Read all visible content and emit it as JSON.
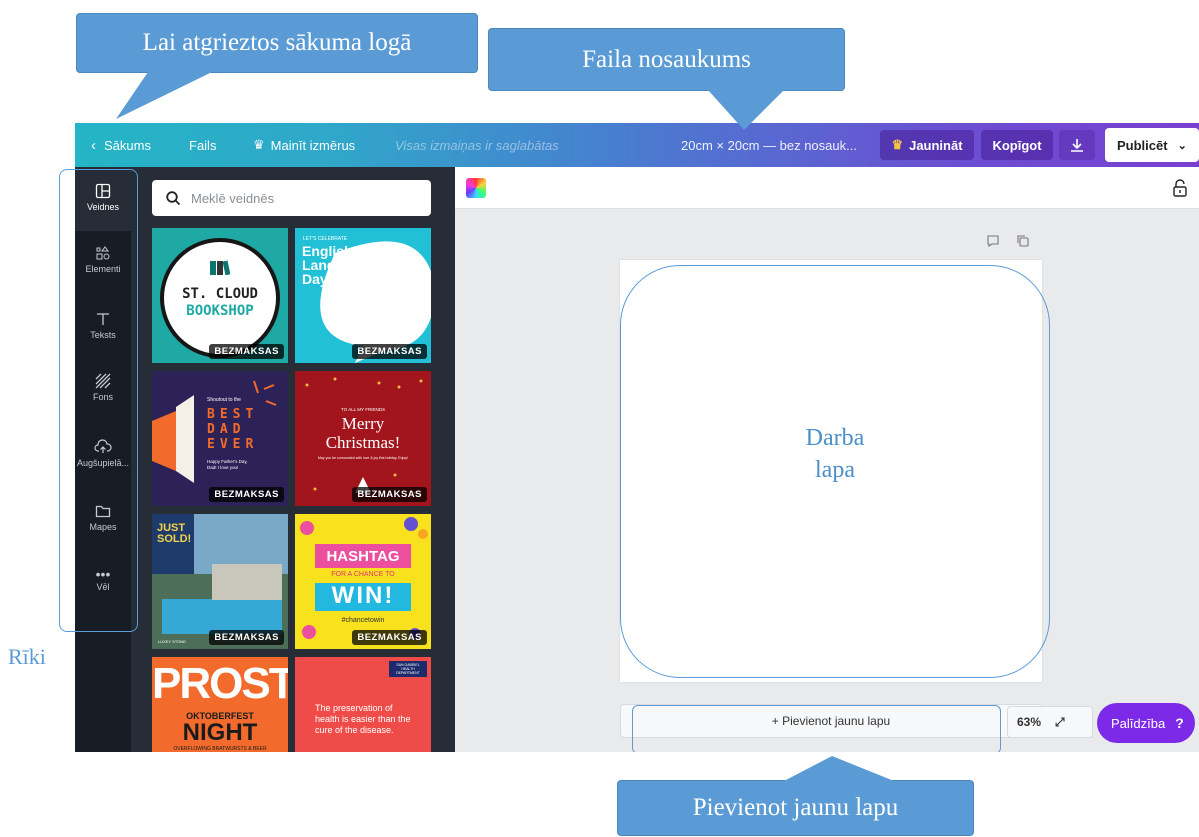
{
  "annotations": {
    "back_to_home": "Lai atgrieztos sākuma logā",
    "file_name": "Faila nosaukums",
    "tools": "Rīki",
    "work_page": [
      "Darba",
      "lapa"
    ],
    "add_page": "Pievienot jaunu lapu"
  },
  "topbar": {
    "home": "Sākums",
    "file": "Fails",
    "resize": "Mainīt izmērus",
    "saved_status": "Visas izmaiņas ir saglabātas",
    "file_title": "20cm × 20cm — bez nosauk...",
    "upgrade": "Jaunināt",
    "share": "Kopīgot",
    "publish": "Publicēt"
  },
  "tools": [
    "Veidnes",
    "Elementi",
    "Teksts",
    "Fons",
    "Augšupielā...",
    "Mapes",
    "Vēl"
  ],
  "panel": {
    "search_placeholder": "Meklē veidnēs",
    "badge": "BEZMAKSAS",
    "templates": {
      "t1": [
        "ST. CLOUD",
        "BOOKSHOP"
      ],
      "t2": [
        "LET'S CELEBRATE",
        "English",
        "Language",
        "Day"
      ],
      "t3": [
        "Shoutout to the",
        "BEST",
        "DAD",
        "EVER",
        "Happy Father's Day,",
        "Dad! I love you!"
      ],
      "t4": [
        "TO ALL MY FRIENDS",
        "Merry",
        "Christmas!",
        "May you be surrounded with love & joy this holiday, Enjoy!"
      ],
      "t5": [
        "JUST",
        "SOLD!",
        "LUXEY STONE"
      ],
      "t6": [
        "HASHTAG",
        "FOR A CHANCE TO",
        "WIN!",
        "#chancetowin"
      ],
      "t7": [
        "PROST!",
        "OKTOBERFEST",
        "NIGHT",
        "OVERFLOWING BRATWURSTS & BEER"
      ],
      "t8": [
        "SAN GABRIEL HEALTH DEPARTMENT",
        "The preservation of health is easier than the cure of the disease."
      ]
    }
  },
  "canvas": {
    "add_page": "+ Pievienot jaunu lapu",
    "zoom": "63%",
    "help": "Palīdzība",
    "help_icon": "?"
  }
}
